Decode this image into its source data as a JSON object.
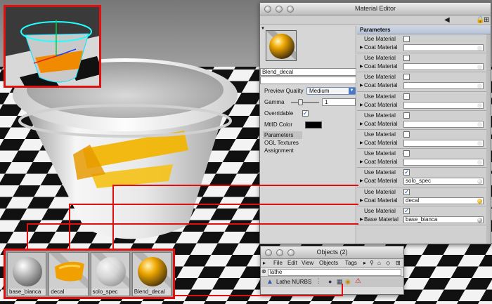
{
  "material_editor": {
    "title": "Material Editor",
    "material_name": "Blend_decal",
    "preview_quality_label": "Preview Quality",
    "preview_quality_value": "Medium",
    "gamma_label": "Gamma",
    "gamma_value": "1",
    "overridable_label": "Overridable",
    "overridable_checked": true,
    "mtlid_color_label": "MtlID Color",
    "mtlid_color": "#000000",
    "tabs": [
      "Parameters",
      "OGL Textures",
      "Assignment"
    ],
    "active_tab": "Parameters",
    "params_header": "Parameters",
    "use_material_label": "Use Material",
    "coat_material_label": "Coat Material",
    "base_material_label": "Base Material",
    "coat_slots": [
      {
        "use": false,
        "coat": ""
      },
      {
        "use": false,
        "coat": ""
      },
      {
        "use": false,
        "coat": ""
      },
      {
        "use": false,
        "coat": ""
      },
      {
        "use": false,
        "coat": ""
      },
      {
        "use": false,
        "coat": ""
      },
      {
        "use": false,
        "coat": ""
      },
      {
        "use": true,
        "coat": "solo_spec"
      },
      {
        "use": true,
        "coat": "decal"
      }
    ],
    "base_slot": {
      "use": true,
      "base": "base_bianca"
    }
  },
  "objects_window": {
    "title": "Objects (2)",
    "menu": [
      "File",
      "Edit",
      "View",
      "Objects",
      "Tags"
    ],
    "search_value": "lathe",
    "object_name": "Lathe NURBS"
  },
  "materials": [
    {
      "name": "base_bianca",
      "icon": "gray-sphere-icon"
    },
    {
      "name": "decal",
      "icon": "yellow-stroke-icon"
    },
    {
      "name": "solo_spec",
      "icon": "clear-sphere-icon"
    },
    {
      "name": "Blend_decal",
      "icon": "blend-sphere-icon"
    }
  ],
  "colors": {
    "highlight": "#e01010",
    "accent_yellow": "#f2b400",
    "checked_blue": "#2855a8"
  }
}
